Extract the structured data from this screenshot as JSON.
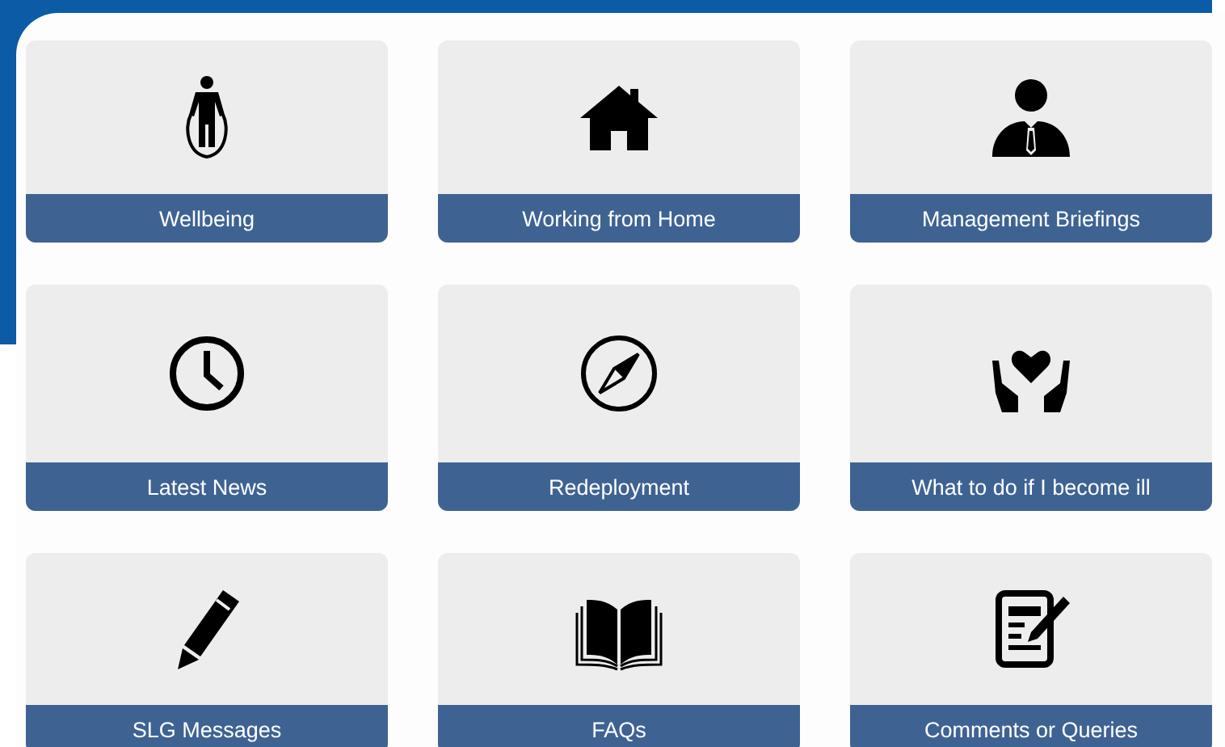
{
  "tiles": [
    {
      "label": "Wellbeing"
    },
    {
      "label": "Working from Home"
    },
    {
      "label": "Management Briefings"
    },
    {
      "label": "Latest News"
    },
    {
      "label": "Redeployment"
    },
    {
      "label": "What to do if I become ill"
    },
    {
      "label": "SLG Messages"
    },
    {
      "label": "FAQs"
    },
    {
      "label": "Comments or Queries"
    }
  ]
}
